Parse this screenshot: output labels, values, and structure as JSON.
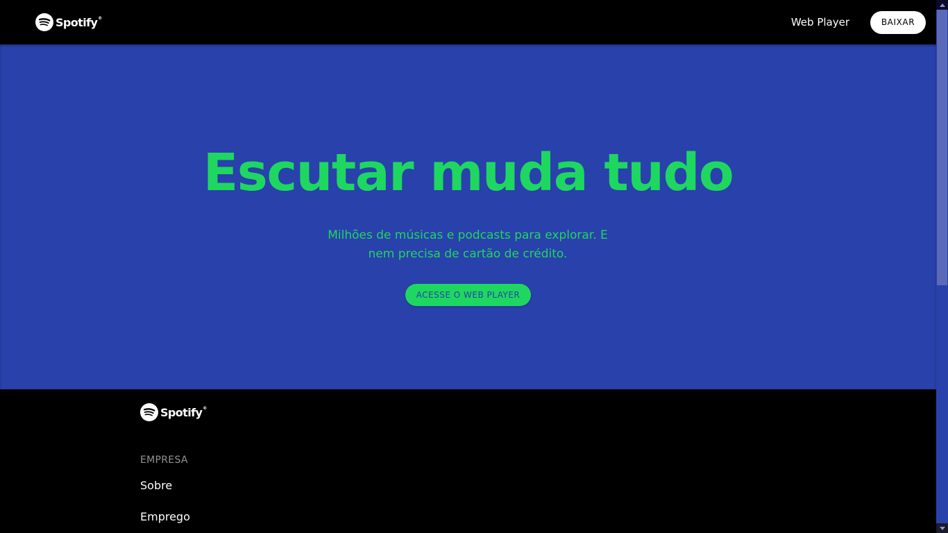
{
  "header": {
    "logo_text": "Spotify",
    "logo_tm": "®",
    "nav_web_player": "Web Player",
    "nav_download": "BAIXAR"
  },
  "hero": {
    "title": "Escutar muda tudo",
    "subtitle": "Milhões de músicas e podcasts para explorar. E nem precisa de cartão de crédito.",
    "cta_label": "ACESSE O WEB PLAYER"
  },
  "footer": {
    "logo_text": "Spotify",
    "logo_tm": "®",
    "section_heading": "EMPRESA",
    "links": [
      "Sobre",
      "Emprego"
    ]
  },
  "colors": {
    "brand_green": "#1ed760",
    "hero_blue": "#2941ab",
    "header_bg": "#000000"
  },
  "icons": {
    "logo": "spotify-logo-icon",
    "scroll_up": "scroll-up-arrow-icon",
    "scroll_down": "scroll-down-arrow-icon"
  }
}
